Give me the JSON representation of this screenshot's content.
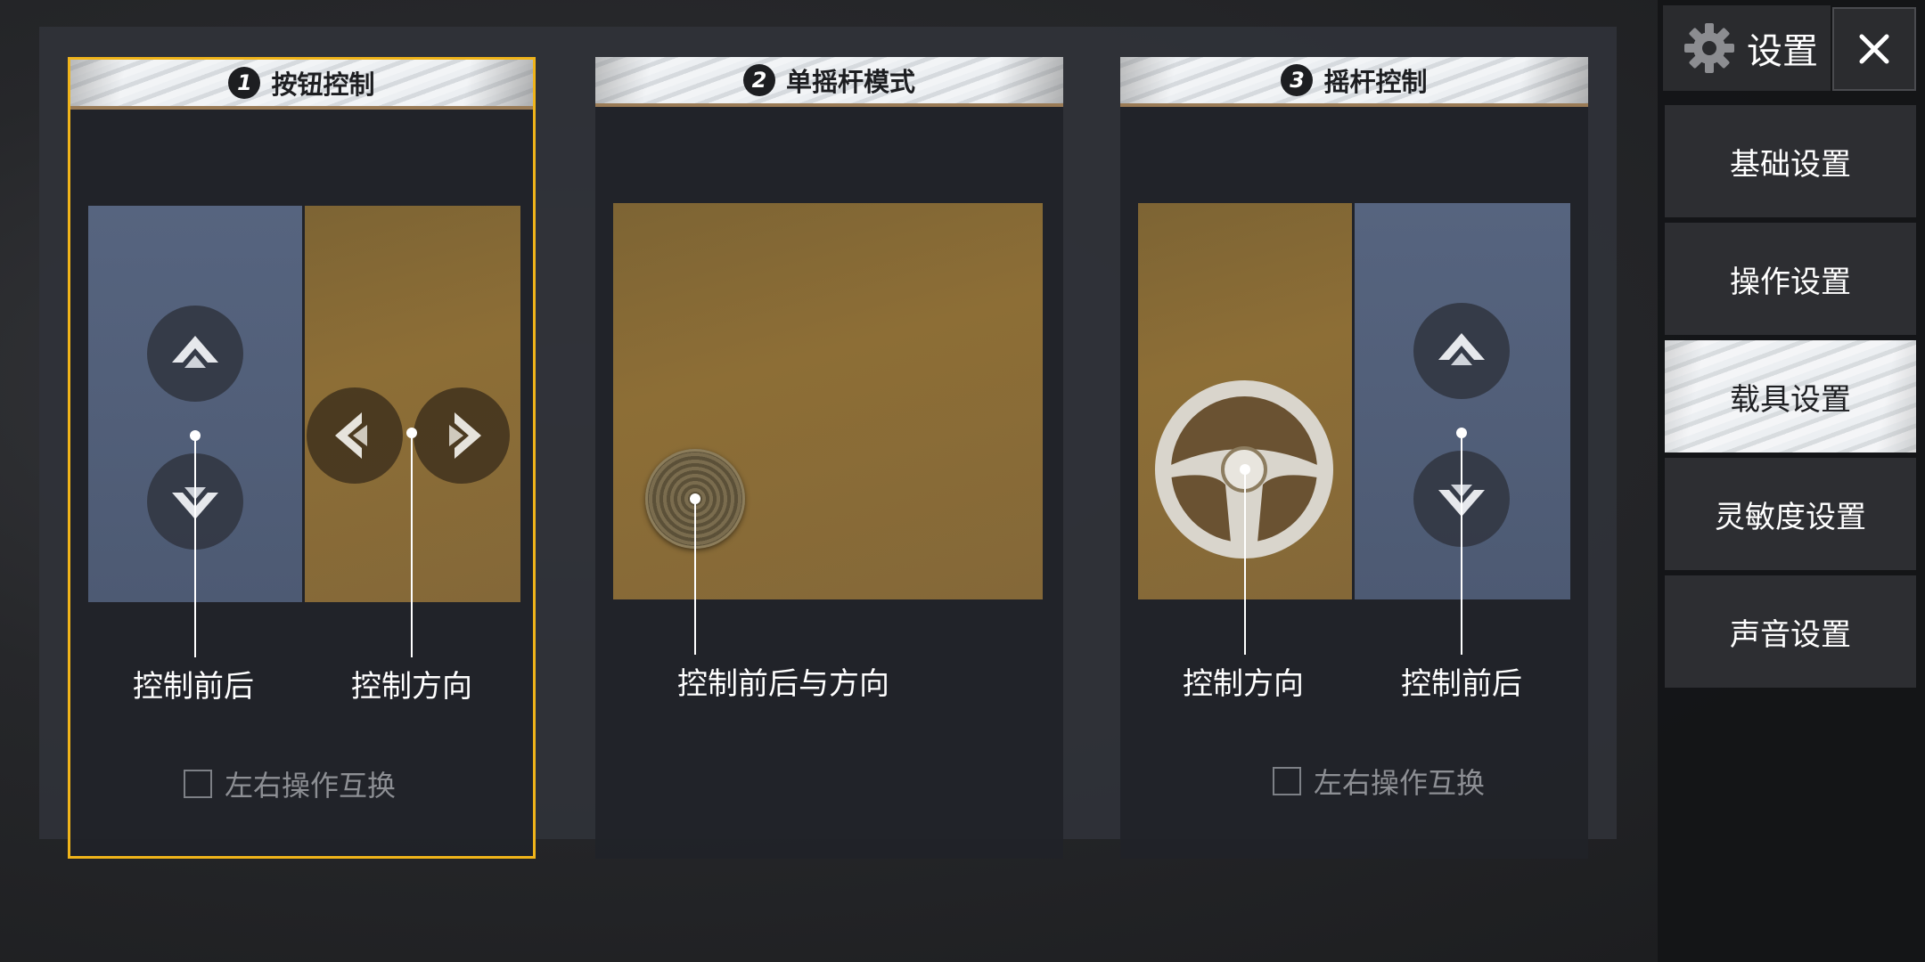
{
  "schemes": [
    {
      "number": "1",
      "title": "按钮控制",
      "selected": true,
      "label_left": "控制前后",
      "label_right": "控制方向",
      "swap_label": "左右操作互换"
    },
    {
      "number": "2",
      "title": "单摇杆模式",
      "selected": false,
      "label_center": "控制前后与方向"
    },
    {
      "number": "3",
      "title": "摇杆控制",
      "selected": false,
      "label_left": "控制方向",
      "label_right": "控制前后",
      "swap_label": "左右操作互换"
    }
  ],
  "sidebar": {
    "title": "设置",
    "settings_icon": "gear-icon",
    "close_icon": "close-icon",
    "items": [
      {
        "label": "基础设置",
        "active": false
      },
      {
        "label": "操作设置",
        "active": false
      },
      {
        "label": "载具设置",
        "active": true
      },
      {
        "label": "灵敏度设置",
        "active": false
      },
      {
        "label": "声音设置",
        "active": false
      }
    ]
  },
  "colors": {
    "selected_border": "#f0b41a",
    "blue_zone": "#56647f",
    "gold_zone": "#8a6c36"
  }
}
